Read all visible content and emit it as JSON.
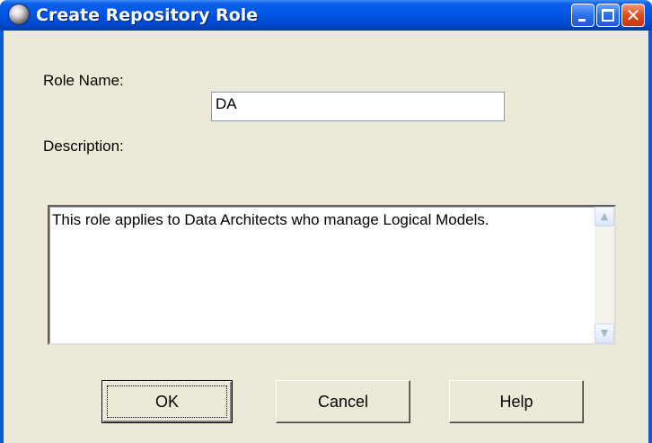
{
  "window": {
    "title": "Create Repository Role",
    "controls": {
      "minimize_icon": "minimize-icon",
      "maximize_icon": "maximize-icon",
      "close_glyph": "✕"
    }
  },
  "form": {
    "role_name_label": "Role Name:",
    "role_name_value": "DA",
    "description_label": "Description:",
    "description_value": "This role applies to Data Architects who manage Logical Models."
  },
  "scrollbar": {
    "up_glyph": "▲",
    "down_glyph": "▼"
  },
  "buttons": {
    "ok": "OK",
    "cancel": "Cancel",
    "help": "Help"
  },
  "colors": {
    "titlebar": "#0055e5",
    "dialog_bg": "#ece9d8",
    "close_button": "#e04a1e"
  }
}
